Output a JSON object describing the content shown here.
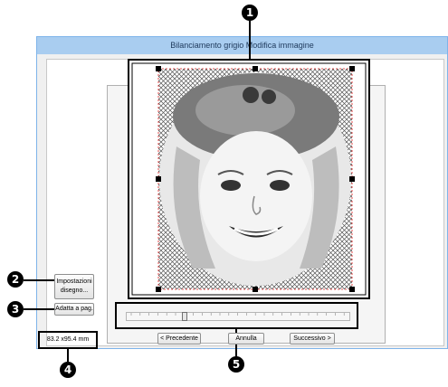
{
  "window": {
    "title": "Bilanciamento grigio Modifica immagine"
  },
  "left_buttons": {
    "settings_line1": "Impostazioni",
    "settings_line2": "disegno...",
    "fit_page": "Adatta a pag."
  },
  "size_readout": "83.2 x95.4 mm",
  "slider": {
    "level": 0.25
  },
  "bottom_buttons": {
    "previous": "< Precedente",
    "cancel": "Annulla",
    "next": "Successivo >"
  },
  "callouts": [
    "1",
    "2",
    "3",
    "4",
    "5"
  ],
  "colors": {
    "title_bar": "#a9cdf0",
    "window_border": "#7eb4ea",
    "selection_outline": "#e02020",
    "callout": "#000000"
  }
}
